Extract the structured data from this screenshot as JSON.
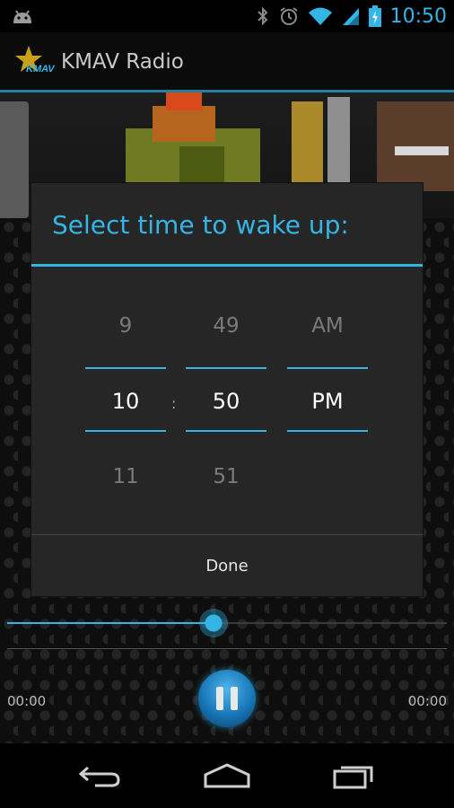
{
  "status_bar": {
    "time": "10:50",
    "icons": [
      "android-notification-icon",
      "bluetooth-icon",
      "alarm-icon",
      "wifi-icon",
      "signal-icon",
      "battery-charging-icon"
    ]
  },
  "action_bar": {
    "logo_text": "KMAV",
    "title": "KMAV Radio"
  },
  "player": {
    "progress": 0.47,
    "elapsed": "00:00",
    "duration": "00:00",
    "state": "playing"
  },
  "dialog": {
    "title": "Select time to wake up:",
    "hour": {
      "prev": "9",
      "current": "10",
      "next": "11"
    },
    "separator": ":",
    "minute": {
      "prev": "49",
      "current": "50",
      "next": "51"
    },
    "ampm": {
      "prev": "AM",
      "current": "PM",
      "next": ""
    },
    "done_label": "Done"
  },
  "colors": {
    "accent": "#33b5e5",
    "dialog_bg": "#262626",
    "background": "#000000"
  },
  "nav_bar": {
    "icons": [
      "back-icon",
      "home-icon",
      "recent-apps-icon"
    ]
  }
}
